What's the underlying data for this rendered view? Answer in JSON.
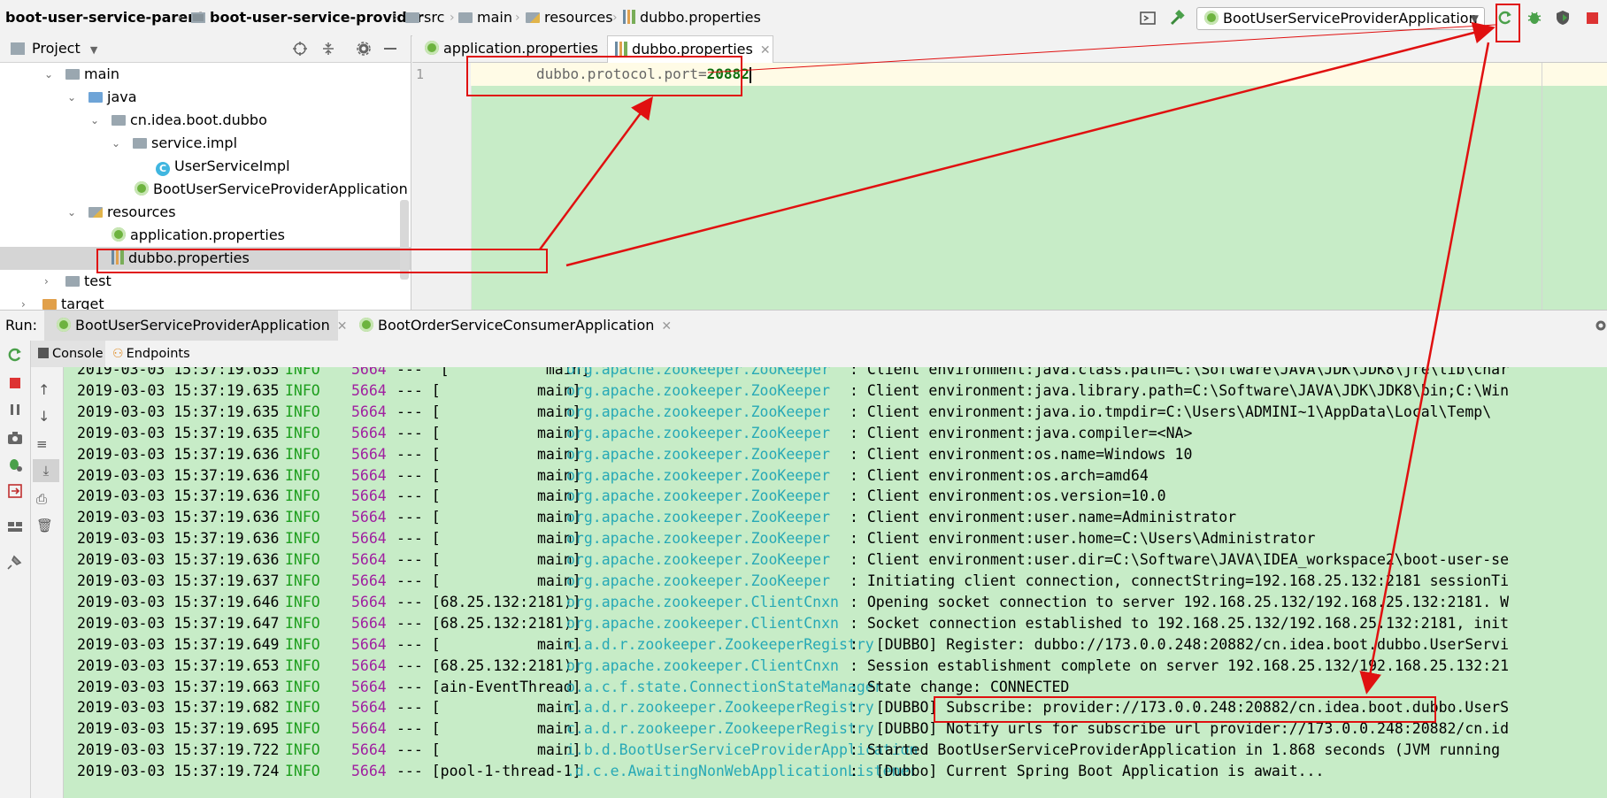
{
  "breadcrumb": [
    "boot-user-service-parent",
    "boot-user-service-provider",
    "src",
    "main",
    "resources",
    "dubbo.properties"
  ],
  "toolbar": {
    "run_config": "BootUserServiceProviderApplication"
  },
  "project_panel": {
    "title": "Project",
    "tree": [
      {
        "label": "main",
        "icon": "folder-icon"
      },
      {
        "label": "java",
        "icon": "folder-icon"
      },
      {
        "label": "cn.idea.boot.dubbo",
        "icon": "package-icon"
      },
      {
        "label": "service.impl",
        "icon": "package-icon"
      },
      {
        "label": "UserServiceImpl",
        "icon": "class-icon"
      },
      {
        "label": "BootUserServiceProviderApplication",
        "icon": "spring-boot-icon"
      },
      {
        "label": "resources",
        "icon": "resources-folder-icon"
      },
      {
        "label": "application.properties",
        "icon": "spring-properties-icon"
      },
      {
        "label": "dubbo.properties",
        "icon": "properties-file-icon"
      },
      {
        "label": "test",
        "icon": "folder-icon"
      },
      {
        "label": "target",
        "icon": "folder-icon"
      }
    ]
  },
  "editor": {
    "tabs": [
      {
        "label": "application.properties",
        "active": false
      },
      {
        "label": "dubbo.properties",
        "active": true
      }
    ],
    "line_number": "1",
    "code_key": "dubbo.protocol.port=",
    "code_value": "20882"
  },
  "run_panel": {
    "label": "Run:",
    "tabs": [
      {
        "label": "BootUserServiceProviderApplication",
        "active": true
      },
      {
        "label": "BootOrderServiceConsumerApplication",
        "active": false
      }
    ],
    "subtabs": [
      "Console",
      "Endpoints"
    ]
  },
  "console": {
    "lines": [
      {
        "ts": "2019-03-03 15:37:19.635",
        "lvl": "INFO",
        "pid": "5664",
        "thread": "---  [           main]",
        "cls": "org.apache.zookeeper.ZooKeeper",
        "msg": ": Client environment:java.class.path=C:\\Software\\JAVA\\JDK\\JDK8\\jre\\lib\\char"
      },
      {
        "ts": "2019-03-03 15:37:19.635",
        "lvl": "INFO",
        "pid": "5664",
        "thread": "--- [           main]",
        "cls": "org.apache.zookeeper.ZooKeeper",
        "msg": ": Client environment:java.library.path=C:\\Software\\JAVA\\JDK\\JDK8\\bin;C:\\Win"
      },
      {
        "ts": "2019-03-03 15:37:19.635",
        "lvl": "INFO",
        "pid": "5664",
        "thread": "--- [           main]",
        "cls": "org.apache.zookeeper.ZooKeeper",
        "msg": ": Client environment:java.io.tmpdir=C:\\Users\\ADMINI~1\\AppData\\Local\\Temp\\"
      },
      {
        "ts": "2019-03-03 15:37:19.635",
        "lvl": "INFO",
        "pid": "5664",
        "thread": "--- [           main]",
        "cls": "org.apache.zookeeper.ZooKeeper",
        "msg": ": Client environment:java.compiler=<NA>"
      },
      {
        "ts": "2019-03-03 15:37:19.636",
        "lvl": "INFO",
        "pid": "5664",
        "thread": "--- [           main]",
        "cls": "org.apache.zookeeper.ZooKeeper",
        "msg": ": Client environment:os.name=Windows 10"
      },
      {
        "ts": "2019-03-03 15:37:19.636",
        "lvl": "INFO",
        "pid": "5664",
        "thread": "--- [           main]",
        "cls": "org.apache.zookeeper.ZooKeeper",
        "msg": ": Client environment:os.arch=amd64"
      },
      {
        "ts": "2019-03-03 15:37:19.636",
        "lvl": "INFO",
        "pid": "5664",
        "thread": "--- [           main]",
        "cls": "org.apache.zookeeper.ZooKeeper",
        "msg": ": Client environment:os.version=10.0"
      },
      {
        "ts": "2019-03-03 15:37:19.636",
        "lvl": "INFO",
        "pid": "5664",
        "thread": "--- [           main]",
        "cls": "org.apache.zookeeper.ZooKeeper",
        "msg": ": Client environment:user.name=Administrator"
      },
      {
        "ts": "2019-03-03 15:37:19.636",
        "lvl": "INFO",
        "pid": "5664",
        "thread": "--- [           main]",
        "cls": "org.apache.zookeeper.ZooKeeper",
        "msg": ": Client environment:user.home=C:\\Users\\Administrator"
      },
      {
        "ts": "2019-03-03 15:37:19.636",
        "lvl": "INFO",
        "pid": "5664",
        "thread": "--- [           main]",
        "cls": "org.apache.zookeeper.ZooKeeper",
        "msg": ": Client environment:user.dir=C:\\Software\\JAVA\\IDEA_workspace2\\boot-user-se"
      },
      {
        "ts": "2019-03-03 15:37:19.637",
        "lvl": "INFO",
        "pid": "5664",
        "thread": "--- [           main]",
        "cls": "org.apache.zookeeper.ZooKeeper",
        "msg": ": Initiating client connection, connectString=192.168.25.132:2181 sessionTi"
      },
      {
        "ts": "2019-03-03 15:37:19.646",
        "lvl": "INFO",
        "pid": "5664",
        "thread": "--- [68.25.132:2181)]",
        "cls": "org.apache.zookeeper.ClientCnxn",
        "msg": ": Opening socket connection to server 192.168.25.132/192.168.25.132:2181. W"
      },
      {
        "ts": "2019-03-03 15:37:19.647",
        "lvl": "INFO",
        "pid": "5664",
        "thread": "--- [68.25.132:2181)]",
        "cls": "org.apache.zookeeper.ClientCnxn",
        "msg": ": Socket connection established to 192.168.25.132/192.168.25.132:2181, init"
      },
      {
        "ts": "2019-03-03 15:37:19.649",
        "lvl": "INFO",
        "pid": "5664",
        "thread": "--- [           main]",
        "cls": "c.a.d.r.zookeeper.ZookeeperRegistry",
        "msg": ":  [DUBBO] Register: dubbo://173.0.0.248:20882/cn.idea.boot.dubbo.UserServi"
      },
      {
        "ts": "2019-03-03 15:37:19.653",
        "lvl": "INFO",
        "pid": "5664",
        "thread": "--- [68.25.132:2181)]",
        "cls": "org.apache.zookeeper.ClientCnxn",
        "msg": ": Session establishment complete on server 192.168.25.132/192.168.25.132:21"
      },
      {
        "ts": "2019-03-03 15:37:19.663",
        "lvl": "INFO",
        "pid": "5664",
        "thread": "--- [ain-EventThread]",
        "cls": "o.a.c.f.state.ConnectionStateManager",
        "msg": ": State change: CONNECTED"
      },
      {
        "ts": "2019-03-03 15:37:19.682",
        "lvl": "INFO",
        "pid": "5664",
        "thread": "--- [           main]",
        "cls": "c.a.d.r.zookeeper.ZookeeperRegistry",
        "msg": ":  [DUBBO] Subscribe: provider://173.0.0.248:20882/cn.idea.boot.dubbo.UserS"
      },
      {
        "ts": "2019-03-03 15:37:19.695",
        "lvl": "INFO",
        "pid": "5664",
        "thread": "--- [           main]",
        "cls": "c.a.d.r.zookeeper.ZookeeperRegistry",
        "msg": ":  [DUBBO] Notify urls for subscribe url provider://173.0.0.248:20882/cn.id"
      },
      {
        "ts": "2019-03-03 15:37:19.722",
        "lvl": "INFO",
        "pid": "5664",
        "thread": "--- [           main]",
        "cls": "i.b.d.BootUserServiceProviderApplication",
        "msg": ": Started BootUserServiceProviderApplication in 1.868 seconds (JVM running"
      },
      {
        "ts": "2019-03-03 15:37:19.724",
        "lvl": "INFO",
        "pid": "5664",
        "thread": "--- [pool-1-thread-1]",
        "cls": ".d.c.e.AwaitingNonWebApplicationListener",
        "msg": ":  [Dubbo] Current Spring Boot Application is await..."
      }
    ]
  },
  "colors": {
    "console_bg": "#c7ecc7",
    "annotation": "#e01010",
    "log_level": "#1e9e1e",
    "pid": "#a020a0",
    "logger": "#27a9b6"
  }
}
